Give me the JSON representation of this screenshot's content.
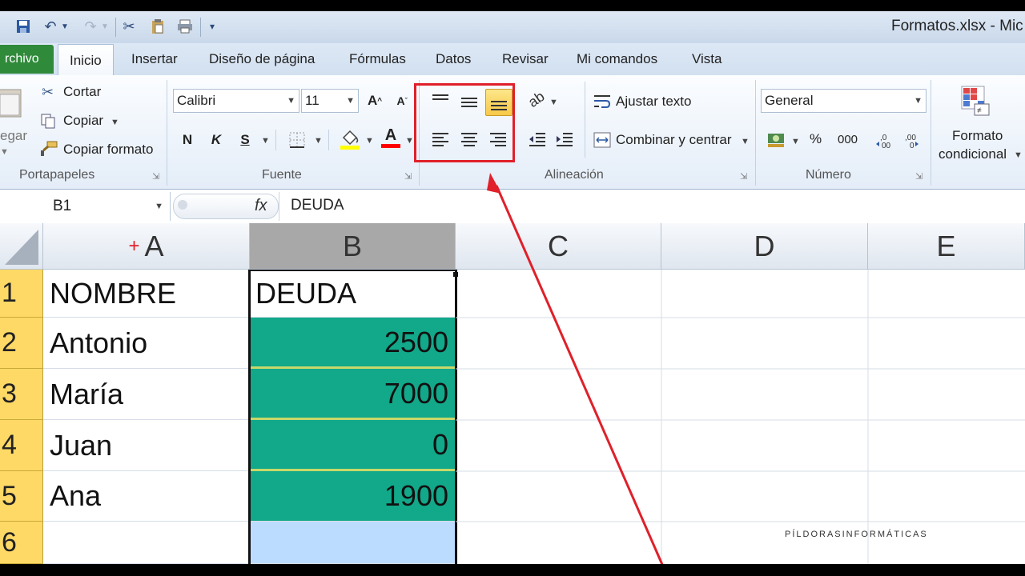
{
  "window": {
    "title": "Formatos.xlsx  -  Mic"
  },
  "quick_access": {
    "icons": [
      "save-icon",
      "undo-icon",
      "redo-icon",
      "cut-icon",
      "paste-icon",
      "print-icon"
    ]
  },
  "tabs": [
    {
      "label": "rchivo"
    },
    {
      "label": "Inicio"
    },
    {
      "label": "Insertar"
    },
    {
      "label": "Diseño de página"
    },
    {
      "label": "Fórmulas"
    },
    {
      "label": "Datos"
    },
    {
      "label": "Revisar"
    },
    {
      "label": "Mi comandos"
    },
    {
      "label": "Vista"
    }
  ],
  "clipboard": {
    "paste_label": "egar",
    "cut": "Cortar",
    "copy": "Copiar",
    "format_painter": "Copiar formato",
    "group": "Portapapeles"
  },
  "font": {
    "name": "Calibri",
    "size": "11",
    "bold": "N",
    "italic": "K",
    "underline": "S",
    "grow": "A",
    "shrink": "A",
    "color_letter": "A",
    "group": "Fuente",
    "fill_color": "#ffff00",
    "font_color": "#ff0000"
  },
  "alignment": {
    "wrap": "Ajustar texto",
    "merge": "Combinar y centrar",
    "group": "Alineación"
  },
  "number": {
    "format": "General",
    "percent": "%",
    "thousands": "000",
    "group": "Número"
  },
  "styles": {
    "cond_line1": "Formato",
    "cond_line2": "condicional"
  },
  "formula_bar": {
    "name_box": "B1",
    "fx": "fx",
    "value": "DEUDA"
  },
  "columns": [
    "A",
    "B",
    "C",
    "D",
    "E"
  ],
  "rows": [
    {
      "num": "1",
      "a": "NOMBRE",
      "b": "DEUDA"
    },
    {
      "num": "2",
      "a": "Antonio",
      "b": "2500"
    },
    {
      "num": "3",
      "a": "María",
      "b": "7000"
    },
    {
      "num": "4",
      "a": "Juan",
      "b": "0"
    },
    {
      "num": "5",
      "a": "Ana",
      "b": "1900"
    },
    {
      "num": "6",
      "a": "",
      "b": ""
    }
  ],
  "watermark": "PÍLDORASINFORMÁTICAS",
  "colors": {
    "highlight_box": "#e0202a",
    "arrow": "#e0202a",
    "teal_fill": "#12a88a",
    "selected_blue": "#bcdcff",
    "row_header_yellow": "#ffd966"
  }
}
